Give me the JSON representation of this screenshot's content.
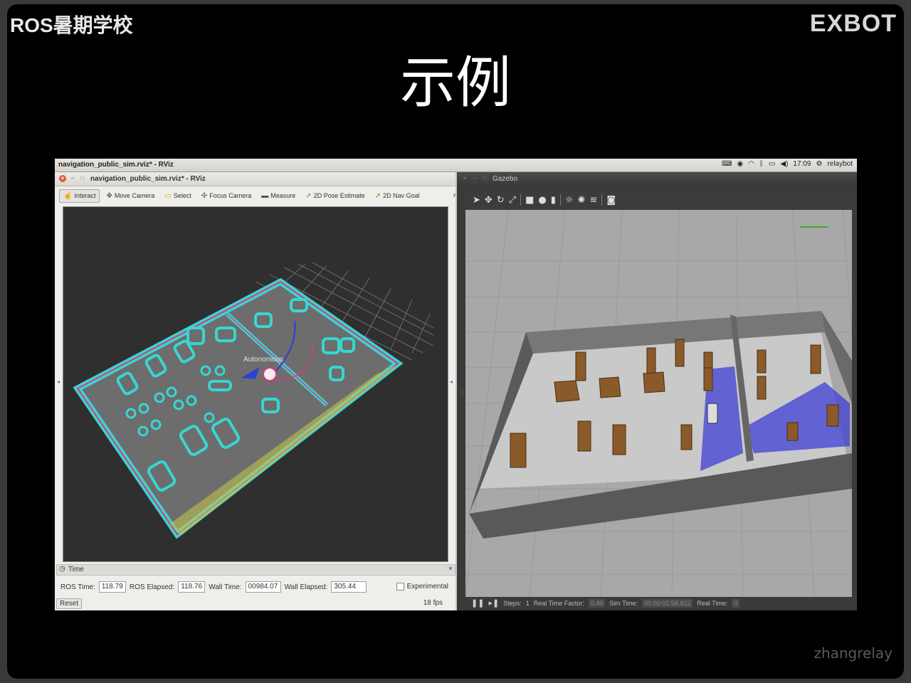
{
  "slide": {
    "brand_left": "ROS暑期学校",
    "brand_right": "EXBOT",
    "title": "示例",
    "watermark": "zhangrelay"
  },
  "topbar": {
    "window_title": "navigation_public_sim.rviz* - RViz",
    "time": "17:09",
    "user": "relaybot"
  },
  "rviz": {
    "title": "navigation_public_sim.rviz* - RViz",
    "tools": [
      {
        "label": "Interact",
        "icon": "hand-icon",
        "active": true
      },
      {
        "label": "Move Camera",
        "icon": "move-camera-icon"
      },
      {
        "label": "Select",
        "icon": "select-icon"
      },
      {
        "label": "Focus Camera",
        "icon": "focus-camera-icon"
      },
      {
        "label": "Measure",
        "icon": "measure-icon"
      },
      {
        "label": "2D Pose Estimate",
        "icon": "pose-arrow-icon"
      },
      {
        "label": "2D Nav Goal",
        "icon": "nav-goal-icon"
      }
    ],
    "robot_label": "Autonomous",
    "time_panel": {
      "title": "Time",
      "ros_time_label": "ROS Time:",
      "ros_time": "118.79",
      "ros_elapsed_label": "ROS Elapsed:",
      "ros_elapsed": "118.76",
      "wall_time_label": "Wall Time:",
      "wall_time": "00984.07",
      "wall_elapsed_label": "Wall Elapsed:",
      "wall_elapsed": "305.44",
      "experimental_label": "Experimental",
      "reset_label": "Reset",
      "fps": "18 fps"
    }
  },
  "gazebo": {
    "title": "Gazebo",
    "status": {
      "steps_label": "Steps:",
      "steps_value": "1",
      "rtf_label": "Real Time Factor:",
      "rtf_value": "0.40",
      "sim_time_label": "Sim Time:",
      "sim_time_value": "00 00:01:58.822",
      "real_time_label": "Real Time:",
      "real_time_value": "0"
    }
  },
  "colors": {
    "costmap_cyan": "#38d6d0",
    "inflation_magenta": "#d63b86",
    "map_gray": "#6d6d6d",
    "gazebo_ground": "#a8a8a8",
    "wall": "#5f5f5f",
    "laser_blue": "#3f3fd6"
  }
}
